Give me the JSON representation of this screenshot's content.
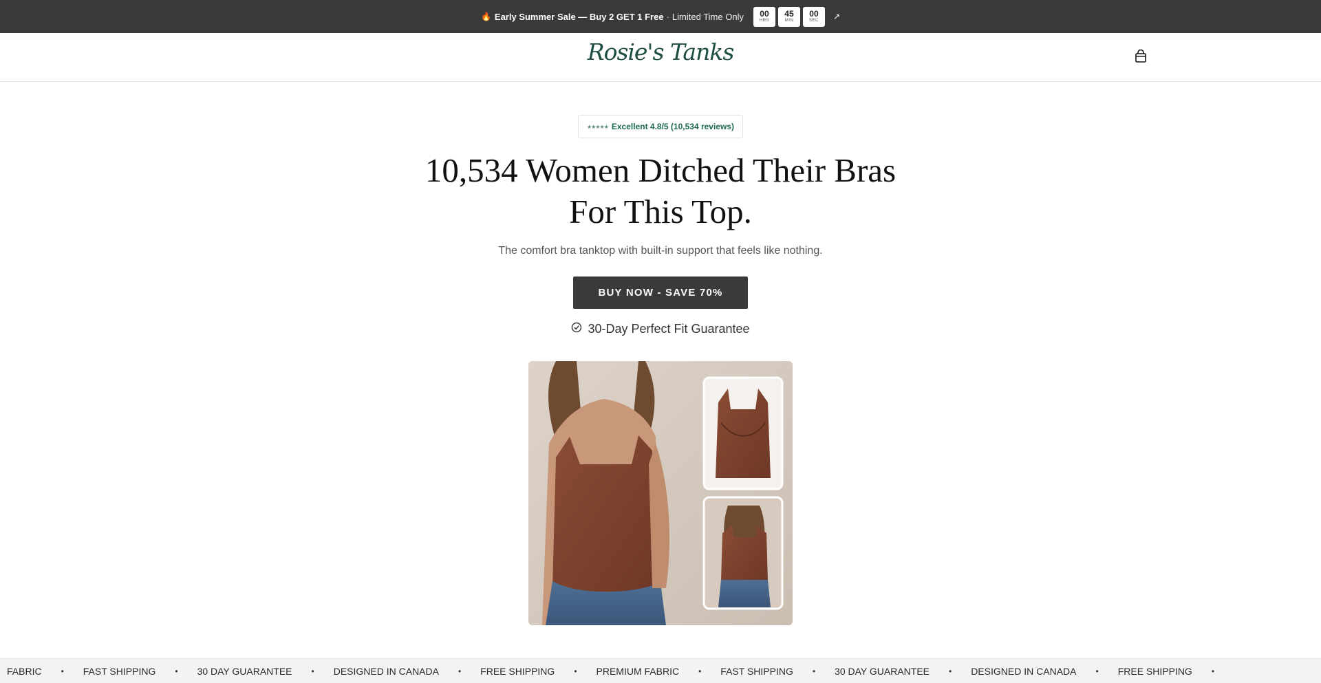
{
  "announcement": {
    "icon": "fire-icon",
    "sale_text": "Early Summer Sale — Buy 2 GET 1 Free",
    "separator": "·",
    "limited_text": "Limited Time Only",
    "timer": {
      "hours": "00",
      "hours_label": "HRS",
      "minutes": "45",
      "minutes_label": "MIN",
      "seconds": "00",
      "seconds_label": "SEC"
    },
    "arrow_icon": "arrow-up-right-icon"
  },
  "header": {
    "logo_text": "Rosie's Tanks",
    "cart_icon": "shopping-bag-icon"
  },
  "hero": {
    "rating_stars": "★★★★★",
    "rating_text": "Excellent 4.8/5 (10,534 reviews)",
    "headline_line1": "10,534 Women Ditched Their Bras",
    "headline_line2": "For This Top.",
    "subheadline": "The comfort bra tanktop with built-in support that feels like nothing.",
    "cta_label": "BUY NOW - SAVE 70%",
    "guarantee_text": "30-Day Perfect Fit Guarantee",
    "guarantee_icon": "check-circle-icon"
  },
  "marquee": {
    "items": [
      "FABRIC",
      "FAST SHIPPING",
      "30 DAY GUARANTEE",
      "DESIGNED IN CANADA",
      "FREE SHIPPING",
      "PREMIUM FABRIC",
      "FAST SHIPPING",
      "30 DAY GUARANTEE",
      "DESIGNED IN CANADA",
      "FREE SHIPPING"
    ],
    "separator": "•"
  },
  "colors": {
    "announcement_bg": "#3a3a3a",
    "logo": "#1e4d44",
    "rating": "#1e6b4a",
    "cta_bg": "#3a3a3a",
    "product": "#7a4330"
  }
}
